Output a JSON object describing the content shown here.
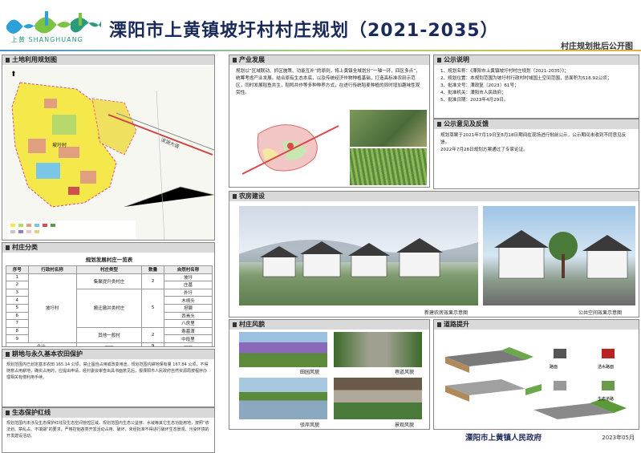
{
  "header": {
    "logo_text": "上黄 SHANGHUANG",
    "title": "溧阳市上黄镇坡圩村村庄规划（2021-2035）",
    "subtitle": "村庄规划批后公开图"
  },
  "land_use": {
    "heading": "土地利用规划图",
    "map_label": "坡圩村",
    "road_label": "滨湖大道"
  },
  "industry": {
    "heading": "产业发展",
    "text": "规划以“区域联动、抓区施策、功能互补”的原则，将上黄镇全域划分“一轴一环，四区多点”，统筹考虑产业发展。结合原有生态本底，以及传统经济作物种植基础，打造高标准农田示范区，同时发展稻鱼共生，稻鸭共作等多种种养方式，在进行传统稻麦种植的同时增加趣味性观赏性。"
  },
  "notice": {
    "heading": "公示说明",
    "items": [
      "1、规划名称：《溧阳市上黄镇坡圩村村庄规划（2021-2035）》；",
      "2、规划位置：本规划范围为坡圩村行政村村域国土空间范围，总面积为518.92公顷；",
      "3、批准文号：溧政复〔2023〕61号；",
      "4、批准机关：溧阳市人民政府；",
      "5、批准日期：2023年4月29日。"
    ]
  },
  "opinion": {
    "heading": "公示意见及反馈",
    "text1": "规划草案于2021年7月19日至8月18日期间在现场进行批前公示，公示期间未收到不同意见反馈。",
    "text2": "2022年7月28日规划方案通过了专家论证。"
  },
  "village": {
    "heading": "村庄分类",
    "caption": "规划发展村庄一览表",
    "columns": [
      "序号",
      "行政村名称",
      "村庄类型",
      "数量",
      "自然村名称"
    ],
    "admin_name": "坡圩村",
    "groups": [
      {
        "type": "集聚提升类村庄",
        "count": "2"
      },
      {
        "type": "搬迁撤并类村庄",
        "count": "5"
      },
      {
        "type": "其他一般村",
        "count": "2"
      }
    ],
    "rows": [
      {
        "no": "1",
        "name": "坡圩"
      },
      {
        "no": "2",
        "name": "庄墓"
      },
      {
        "no": "3",
        "name": "外圩"
      },
      {
        "no": "4",
        "name": "木柄头"
      },
      {
        "no": "5",
        "name": "坦獭"
      },
      {
        "no": "6",
        "name": "西焉头"
      },
      {
        "no": "7",
        "name": "八房里"
      },
      {
        "no": "8",
        "name": "寿墓渡"
      },
      {
        "no": "9",
        "name": "中段里"
      }
    ],
    "total_label": "合计",
    "total_count": "9",
    "dash": "——"
  },
  "farm": {
    "heading": "耕地与永久基本农田保护",
    "text": "规划范围内已划定基本农田 165.14 公顷，禁止擅自占用或改变用途。规划范围内耕地保有量 167.84 公顷，不得随意占用耕地，确实占用的，应提出申请，经村委会审查出具书面意见后，报溧阳市人民政府自然资源局按程序办理相关有偿利用手续。"
  },
  "eco": {
    "heading": "生态保护红线",
    "text": "规划范围内未涉及生态保护红线及生态空间管控区域。规划范围内生态公益林、水域等其它生态功能用地，按照“依法划、禁乱占、不填湖”的要求，严格控制各类开发活动占用、破坏，未经批准不得进行破坏生态景观、污染环境的开发建设活动。"
  },
  "housing": {
    "heading": "农房建设",
    "caption1": "新建农房效果示意图",
    "caption2": "公共空间效果示意图"
  },
  "style": {
    "heading": "村庄风貌",
    "captions": [
      "田园风貌",
      "巷道风貌",
      "驳岸风貌",
      "景观风貌"
    ]
  },
  "road": {
    "heading": "道路提升",
    "labels": [
      "路面",
      "透水路面",
      "生态道路"
    ]
  },
  "footer": {
    "gov": "溧阳市上黄镇人民政府",
    "date": "2023年05月"
  },
  "colors": {
    "title": "#1a2a5a",
    "brand_green": "#2a9a7a",
    "farmland": "#f5e84a",
    "village": "#e0a080"
  }
}
